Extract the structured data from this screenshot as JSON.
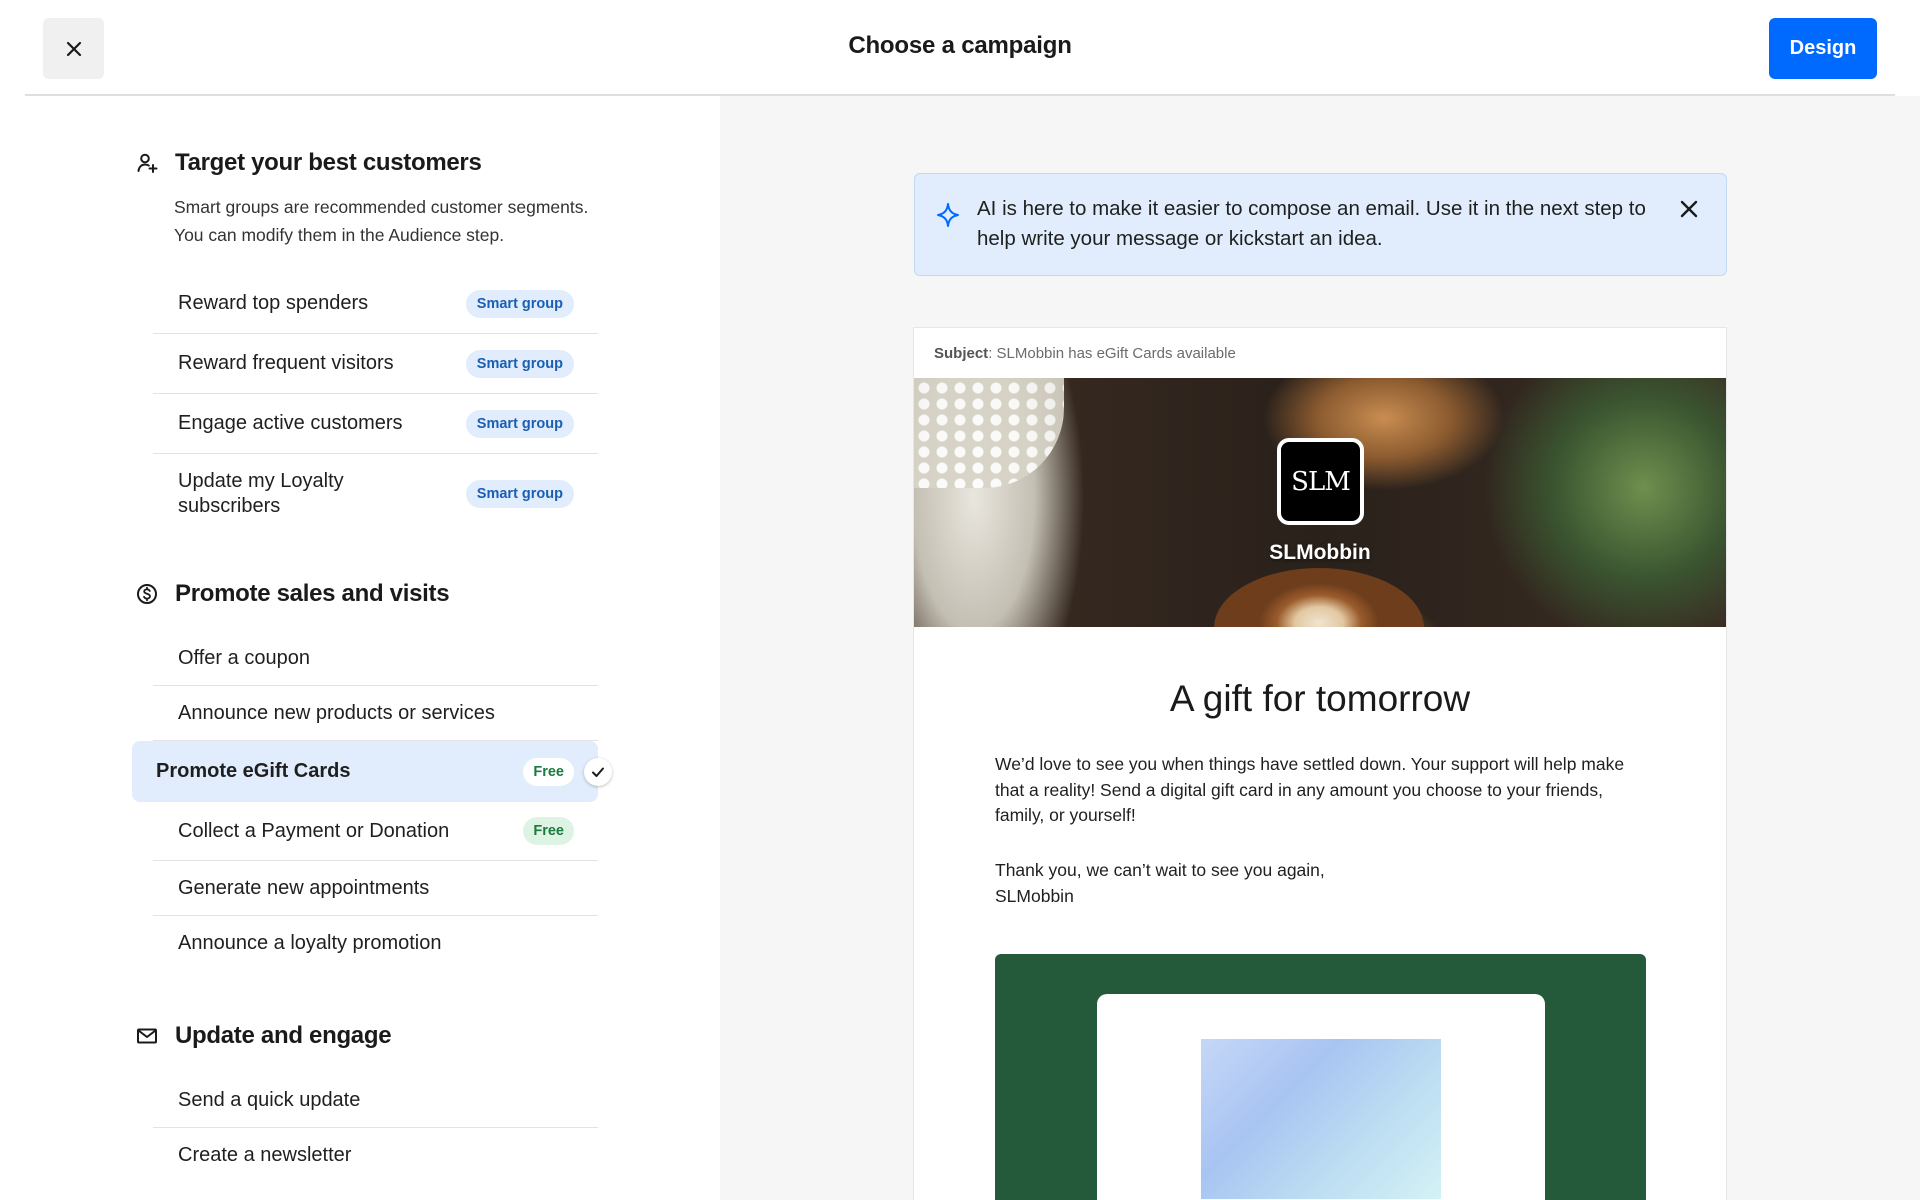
{
  "header": {
    "title": "Choose a campaign",
    "close_icon": "close-icon",
    "design_label": "Design"
  },
  "colors": {
    "accent": "#006aff",
    "smart_badge_bg": "#e1edfc",
    "free_badge_bg": "#ddf3e4",
    "selected_row_bg": "#e1edfc",
    "gift_panel": "#245a3a"
  },
  "sections": {
    "target": {
      "icon": "person-plus-icon",
      "title": "Target your best customers",
      "desc_line1": "Smart groups are recommended customer segments.",
      "desc_line2": "You can modify them in the Audience step.",
      "items": [
        {
          "label": "Reward top spenders",
          "badge": "Smart group"
        },
        {
          "label": "Reward frequent visitors",
          "badge": "Smart group"
        },
        {
          "label": "Engage active customers",
          "badge": "Smart group"
        },
        {
          "label_line1": "Update my Loyalty",
          "label_line2": "subscribers",
          "badge": "Smart group"
        }
      ]
    },
    "promote": {
      "icon": "dollar-circle-icon",
      "title": "Promote sales and visits",
      "items": [
        {
          "label": "Offer a coupon"
        },
        {
          "label": "Announce new products or services"
        },
        {
          "label": "Promote eGift Cards",
          "badge": "Free",
          "selected": true
        },
        {
          "label": "Collect a Payment or Donation",
          "badge": "Free"
        },
        {
          "label": "Generate new appointments"
        },
        {
          "label": "Announce a loyalty promotion"
        }
      ]
    },
    "engage": {
      "icon": "envelope-icon",
      "title": "Update and engage",
      "items": [
        {
          "label": "Send a quick update"
        },
        {
          "label": "Create a newsletter"
        }
      ]
    }
  },
  "ai_banner": {
    "icon": "sparkle-icon",
    "text": "AI is here to make it easier to compose an email. Use it in the next step to help write your message or kickstart an idea.",
    "close_icon": "close-icon"
  },
  "email": {
    "subject_label": "Subject",
    "subject_value": ": SLMobbin has eGift Cards available",
    "logo_text": "SLM",
    "brand_name": "SLMobbin",
    "headline": "A gift for tomorrow",
    "body": "We’d love to see you when things have settled down. Your support will help make that a reality! Send a digital gift card in any amount you choose to your friends, family, or yourself!",
    "signoff_line1": "Thank you, we can’t wait to see you again,",
    "signoff_line2": "SLMobbin"
  }
}
